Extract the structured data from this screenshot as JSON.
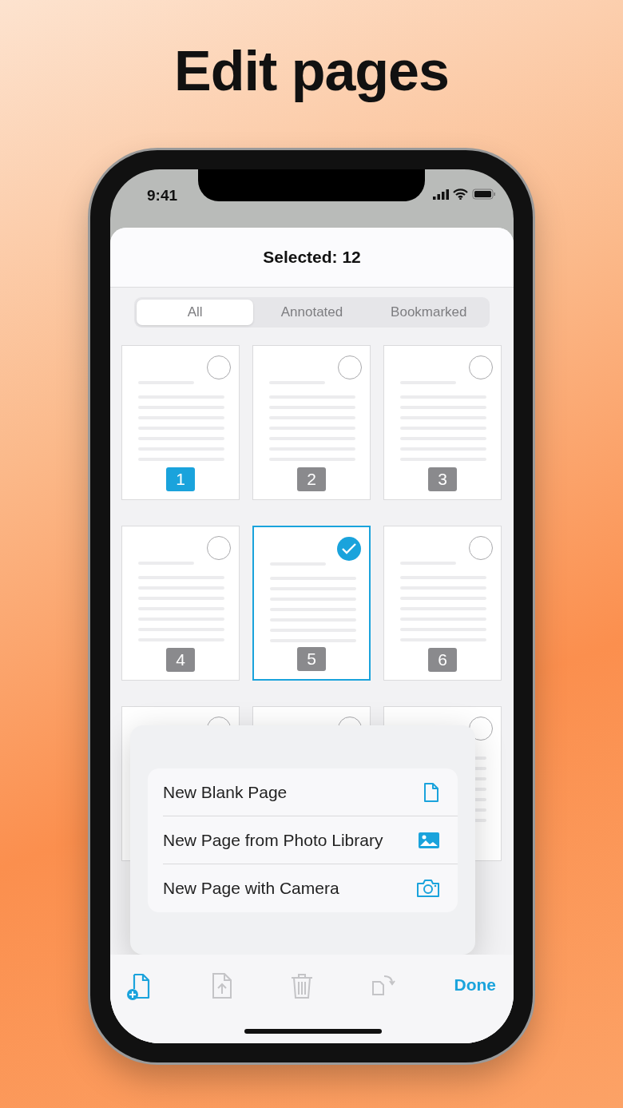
{
  "headline": "Edit pages",
  "status_bar": {
    "time": "9:41"
  },
  "header": {
    "title": "Selected: 12"
  },
  "tabs": [
    {
      "label": "All",
      "selected": true
    },
    {
      "label": "Annotated",
      "selected": false
    },
    {
      "label": "Bookmarked",
      "selected": false
    }
  ],
  "pages": [
    {
      "number": "1",
      "selected": false,
      "current": true
    },
    {
      "number": "2",
      "selected": false,
      "current": false
    },
    {
      "number": "3",
      "selected": false,
      "current": false
    },
    {
      "number": "4",
      "selected": false,
      "current": false
    },
    {
      "number": "5",
      "selected": true,
      "current": false
    },
    {
      "number": "6",
      "selected": false,
      "current": false
    },
    {
      "selected": false,
      "kind": "covered"
    },
    {
      "selected": false,
      "kind": "covered"
    },
    {
      "selected": false,
      "kind": "partly_covered"
    }
  ],
  "add_menu": [
    {
      "label": "New Blank Page",
      "kind": "blank"
    },
    {
      "label": "New Page from Photo Library",
      "kind": "photo"
    },
    {
      "label": "New Page with Camera",
      "kind": "camera"
    }
  ],
  "toolbar": [
    {
      "kind": "add",
      "disabled": false
    },
    {
      "kind": "export",
      "disabled": true
    },
    {
      "kind": "delete",
      "disabled": true
    },
    {
      "kind": "rotate",
      "disabled": true
    }
  ],
  "done_button": {
    "label": "Done"
  }
}
